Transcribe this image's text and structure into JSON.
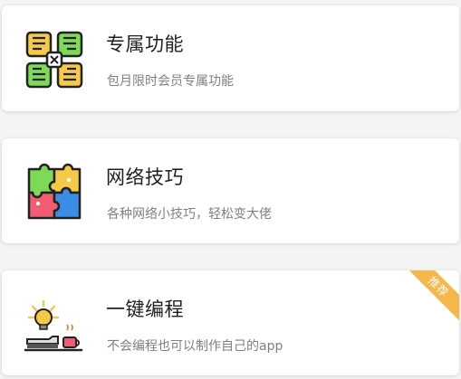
{
  "items": [
    {
      "title": "专属功能",
      "description": "包月限时会员专属功能",
      "icon": "hands-unity-icon"
    },
    {
      "title": "网络技巧",
      "description": "各种网络小技巧，轻松变大佬",
      "icon": "puzzle-icon"
    },
    {
      "title": "一键编程",
      "description": "不会编程也可以制作自己的app",
      "icon": "idea-book-coffee-icon",
      "badge": "推荐"
    }
  ],
  "colors": {
    "badge": "#f5b64a",
    "title": "#1f1f1f",
    "description": "#808080",
    "yellow": "#f7c948",
    "green": "#7ed957",
    "red": "#f25c72",
    "blue": "#3a8ee6"
  }
}
